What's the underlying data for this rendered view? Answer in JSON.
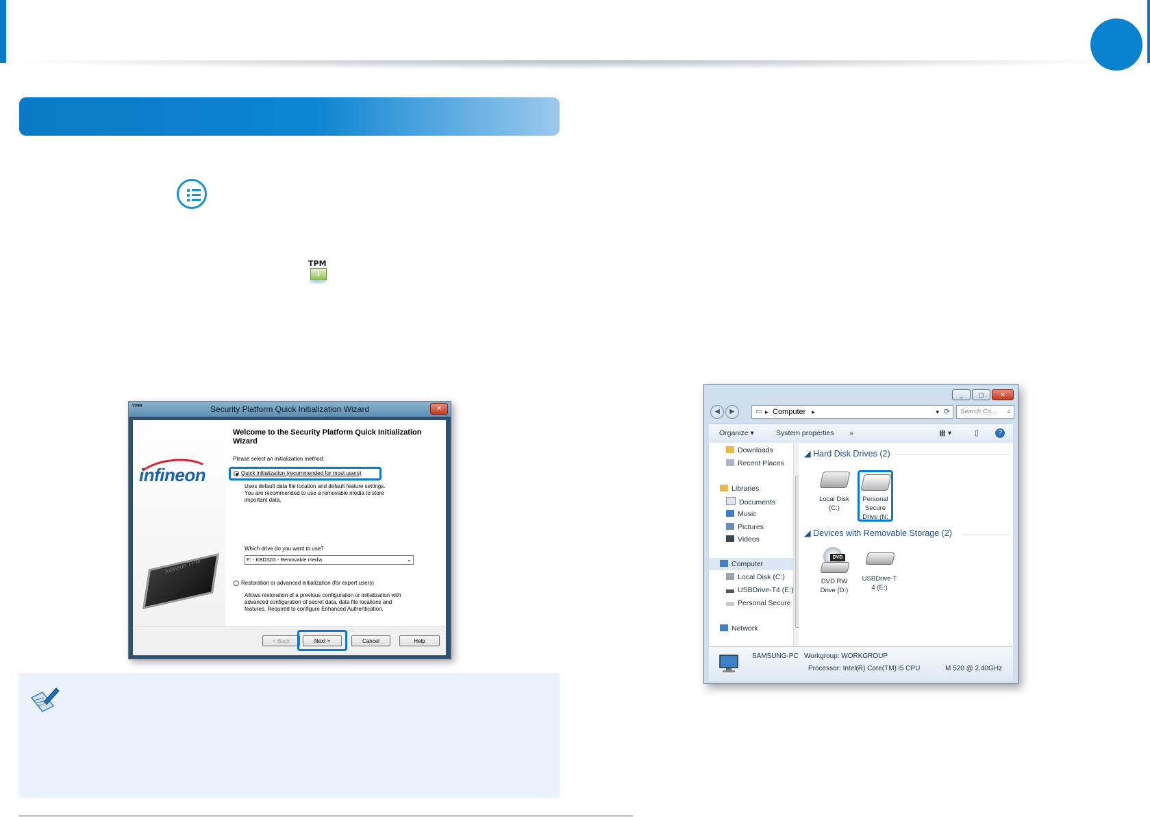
{
  "wizard": {
    "title_icon": "TPM",
    "title": "Security Platform Quick Initialization Wizard",
    "close": "✕",
    "logo": "infineon",
    "chip_label": "Infineon TPM",
    "heading": "Welcome to the Security Platform Quick Initialization Wizard",
    "prompt": "Please select an initialization method:",
    "option_quick": "Quick initialization (recommended for most users)",
    "option_quick_desc1": "Uses default data file location and default feature settings.",
    "option_quick_desc2": "You are recommended to use a removable media to store",
    "option_quick_desc3": "important data.",
    "drive_prompt": "Which drive do you want to use?",
    "drive_value": "F: - KBD32G - Removable media",
    "option_advanced": "Restoration or advanced initialization (for expert users)",
    "option_advanced_desc1": "Allows restoration of a previous configuration or initialization with",
    "option_advanced_desc2": "advanced configuration of secret data, data file locations and",
    "option_advanced_desc3": "features. Required to configure Enhanced Authentication.",
    "back": "< Back",
    "next": "Next >",
    "cancel": "Cancel",
    "help": "Help"
  },
  "tpm_icon": {
    "label": "TPM",
    "badge": "i"
  },
  "explorer": {
    "address": "Computer",
    "search_placeholder": "Search Co...",
    "organize": "Organize ▾",
    "system_properties": "System properties",
    "more": "»",
    "nav": {
      "downloads": "Downloads",
      "recent": "Recent Places",
      "libraries": "Libraries",
      "documents": "Documents",
      "music": "Music",
      "pictures": "Pictures",
      "videos": "Videos",
      "computer": "Computer",
      "local_disk": "Local Disk (C:)",
      "usb": "USBDrive-T4 (E:)",
      "personal": "Personal Secure D",
      "network": "Network"
    },
    "group_hdd": "Hard Disk Drives (2)",
    "group_removable": "Devices with Removable Storage (2)",
    "drive_c_1": "Local Disk",
    "drive_c_2": "(C:)",
    "drive_n_1": "Personal",
    "drive_n_2": "Secure",
    "drive_n_3": "Drive (N:",
    "dvd_badge": "DVD",
    "drive_d_1": "DVD RW",
    "drive_d_2": "Drive (D:)",
    "drive_e_1": "USBDrive-T",
    "drive_e_2": "4 (E:)",
    "pc_name": "SAMSUNG-PC",
    "workgroup": "Workgroup: WORKGROUP",
    "processor": "Processor: Intel(R) Core(TM) i5 CPU",
    "speed": "M 520  @ 2.40GHz"
  },
  "colors": {
    "accent": "#0a7ac6",
    "highlight": "#0a7ac6",
    "note_bg": "#eaf3fb"
  }
}
